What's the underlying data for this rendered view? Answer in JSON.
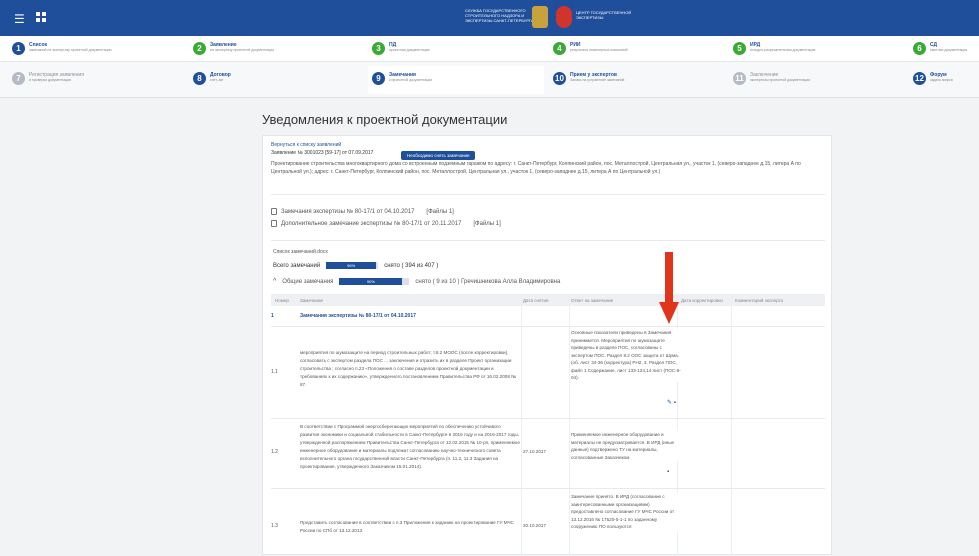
{
  "header": {
    "menu_icon": "hamburger-icon",
    "grid_icon": "grid-icon",
    "org1": [
      "СЛУЖБА ГОСУДАРСТВЕННОГО",
      "СТРОИТЕЛЬНОГО НАДЗОРА И",
      "ЭКСПЕРТИЗЫ САНКТ-ПЕТЕРБУРГА"
    ],
    "org2": [
      "ЦЕНТР ГОСУДАРСТВЕННОЙ",
      "ЭКСПЕРТИЗЫ"
    ]
  },
  "steps_row1": [
    {
      "num": "1",
      "title": "Список",
      "sub": "замечаний на экспертизу проектной документации",
      "state": "blue"
    },
    {
      "num": "2",
      "title": "Заявление",
      "sub": "на экспертизу проектной документации",
      "state": "green"
    },
    {
      "num": "3",
      "title": "ПД",
      "sub": "проектная документация",
      "state": "green"
    },
    {
      "num": "4",
      "title": "РИИ",
      "sub": "результаты инженерных изысканий",
      "state": "green"
    },
    {
      "num": "5",
      "title": "ИРД",
      "sub": "исходно-разрешительная документация",
      "state": "green"
    },
    {
      "num": "6",
      "title": "СД",
      "sub": "сметная документация",
      "state": "green"
    }
  ],
  "steps_row2": [
    {
      "num": "7",
      "title": "Регистрация заявления",
      "sub": "и проверка документации",
      "state": "gray"
    },
    {
      "num": "8",
      "title": "Договор",
      "sub": "счет, акт",
      "state": "blue"
    },
    {
      "num": "9",
      "title": "Замечания",
      "sub": "к проектной документации",
      "state": "blue"
    },
    {
      "num": "10",
      "title": "Прием у экспертов",
      "sub": "Запись на устранение замечаний",
      "state": "blue"
    },
    {
      "num": "11",
      "title": "Заключение",
      "sub": "экспертизы проектной документации",
      "state": "gray"
    },
    {
      "num": "12",
      "title": "Форум",
      "sub": "задать вопрос",
      "state": "blue"
    }
  ],
  "page": {
    "title": "Уведомления к проектной документации",
    "back_link": "Вернуться к списку заявлений",
    "meta": "Заявление № 3001023 [59-17] от 07.09.2017",
    "need_button": "Необходимо снять замечание",
    "description": "Проектирование строительства многоквартирного дома со встроенным подземным гаражом по адресу: г. Санкт-Петербург, Колпинский район, пос. Металлострой, Центральная ул., участок 1, (северо-западнее д.15, литера А по Центральной ул.); адрес: г. Санкт-Петербург, Колпинский район, пос. Металлострой, Центральная ул., участок 1, (северо-западнее д.15, литера А по Центральной ул.)",
    "docs": [
      {
        "label": "Замечания экспертизы № 80-17/1 от 04.10.2017",
        "files": "[Файлы 1]"
      },
      {
        "label": "Дополнительное замечание экспертизы № 80-17/1 от 20.11.2017",
        "files": "[Файлы 1]"
      }
    ],
    "list_link": "Список замечаний.docx",
    "total_label": "Всего замечаний",
    "total_progress": 96,
    "total_progress_label": "96%",
    "total_removed": "снято ( 394 из 407 )",
    "general_label": "Общие замечания",
    "general_progress": 90,
    "general_progress_label": "90%",
    "general_removed": "снято ( 9 из 10 ) Гречишникова Алла Владимировна"
  },
  "table": {
    "headers": [
      "Номер",
      "Замечание",
      "Дата снятия",
      "Ответ на замечание",
      "Дата корректировки",
      "Комментарий эксперта"
    ],
    "section": {
      "num": "1",
      "label": "Замечания экспертизы № 80-17/1 от 04.10.2017"
    },
    "rows": [
      {
        "num": "1.1",
        "comment": "мероприятия по шумозащите на период строительных работ; т.8.2 МООС (после корректировки), согласовать с экспертом раздела ПОС ... заключения и отразить их в разделе Проект организации строительства ; согласно п.23 «Положения о составе разделов проектной документации и требованиях к их содержанию», утвержденного постановлением Правительства РФ от 16.02.2008 № 87.",
        "date": "",
        "answer": "Основные показатели приведены в Замечания принимается. Мероприятия по шумозащите приведены в разделе ПОС, согласованы с экспертом ПОС. Раздел 8.2 ООС защита от Шума. (об. лист 34-36 (корректура) PH2, 3. Раздел ПОС, файл 1 Содержание, лист 133-134,14 лист (ПОС-6-04)."
      },
      {
        "num": "1.2",
        "comment": "В соответствии с Программой энергосберегающих мероприятий по обеспечению устойчивого развития экономики и социальной стабильности в Санкт-Петербурге в 2015 году и на 2016-2017 годы, утвержденной распоряжением Правительства Санкт-Петербурга от 12.02.2015 № 10-рп, применяемое инженерное оборудование и материалы подлежат согласованию научно-технического совета исполнительного органа государственной власти Санкт-Петербурга (п. 11.2, 11.3 Задания на проектирование, утвержденного Заказчиком 15.01.2014).",
        "date": "27.10.2017",
        "answer": "Применяемое инженерное оборудование и материалы не предусматривается. В ИРД (иные данные) подтвержено ТУ на материалы, согласованные Заказчиком"
      },
      {
        "num": "1.3",
        "comment": "Представить согласование в соответствии с п.3 Приложения к заданию на проектирование ГУ МЧС России по СПб от 13.12.2013.",
        "date": "20.10.2017",
        "answer": "Замечание принято. В ИРД (согласование с заинтересованными организациями) предоставлено согласование ГУ МЧС России от 13.12.2016 № 17520-0-1-1 по заданному сооружению ПО пользуются"
      }
    ]
  },
  "icons": {
    "edit": "pencil-icon",
    "message": "message-icon",
    "doc": "document-icon",
    "arrow": "red-arrow-down-icon"
  },
  "colors": {
    "brand": "#1f4f9a",
    "step_green": "#3aaa35",
    "step_gray": "#b5bbc4",
    "arrow": "#e0341b"
  }
}
